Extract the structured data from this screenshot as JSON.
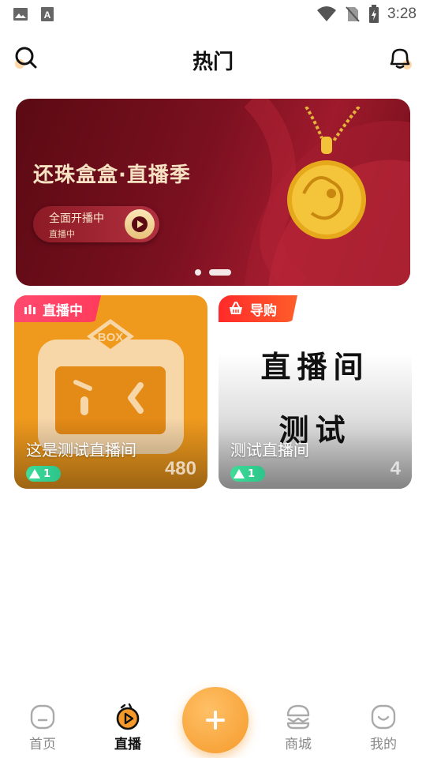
{
  "status_bar": {
    "time": "3:28"
  },
  "header": {
    "title": "热门"
  },
  "banner": {
    "title": "还珠盒盒·直播季",
    "pill_main": "全面开播中",
    "pill_sub": "直播中",
    "slides_total": 2,
    "slide_active": 2
  },
  "cards": [
    {
      "tag": "直播中",
      "name": "这是测试直播间",
      "level": "1",
      "count": "480"
    },
    {
      "tag": "导购",
      "cover_text_line1": "直播间",
      "cover_text_line2": "测试",
      "name": "测试直播间",
      "level": "1",
      "count": "4"
    }
  ],
  "bottom_nav": {
    "items": [
      {
        "label": "首页",
        "icon": "home-face-icon"
      },
      {
        "label": "直播",
        "icon": "live-play-icon",
        "active": true
      },
      {
        "label": "商城",
        "icon": "mall-burger-icon"
      },
      {
        "label": "我的",
        "icon": "profile-smile-icon"
      }
    ],
    "fab_icon": "plus-icon"
  },
  "colors": {
    "accent": "#f59a2a",
    "live_tag": "#ff3b5c",
    "banner": "#7a1020"
  }
}
